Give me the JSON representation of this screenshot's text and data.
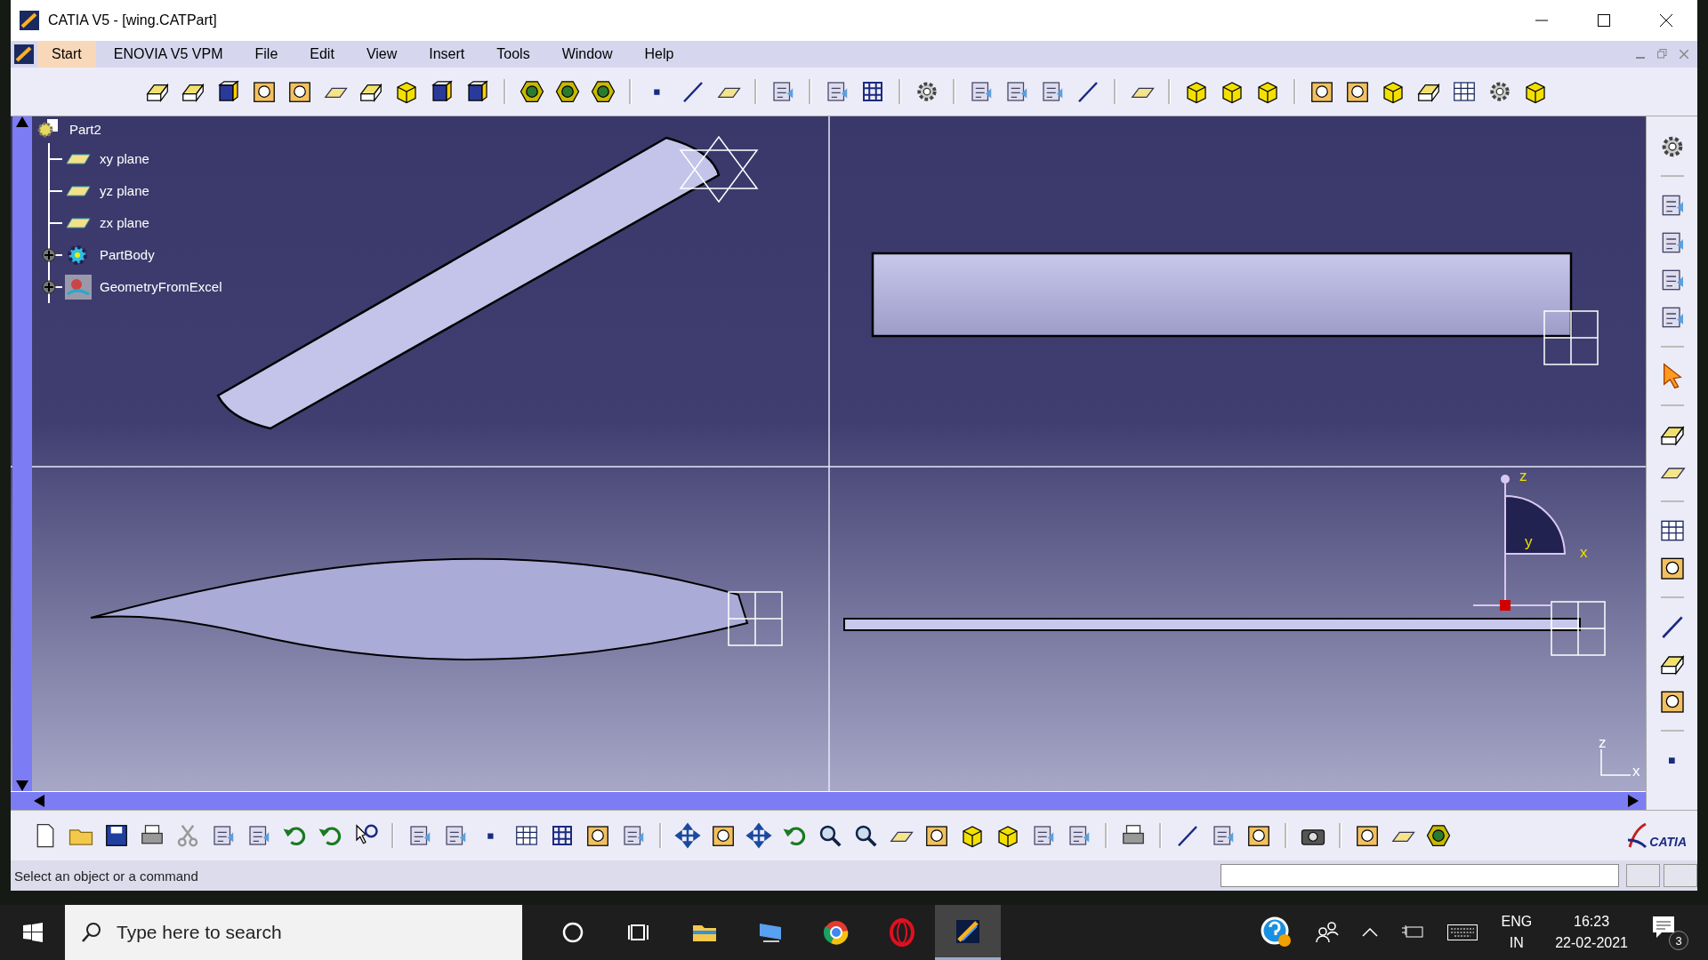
{
  "window": {
    "title": "CATIA V5 - [wing.CATPart]"
  },
  "menu": [
    {
      "label": "Start",
      "selected": true
    },
    {
      "label": "ENOVIA V5 VPM",
      "selected": false
    },
    {
      "label": "File",
      "selected": false
    },
    {
      "label": "Edit",
      "selected": false
    },
    {
      "label": "View",
      "selected": false
    },
    {
      "label": "Insert",
      "selected": false
    },
    {
      "label": "Tools",
      "selected": false
    },
    {
      "label": "Window",
      "selected": false
    },
    {
      "label": "Help",
      "selected": false
    }
  ],
  "tree": {
    "label": "Part2",
    "kind": "part",
    "children": [
      {
        "label": "xy plane",
        "kind": "plane"
      },
      {
        "label": "yz plane",
        "kind": "plane"
      },
      {
        "label": "zx plane",
        "kind": "plane"
      },
      {
        "label": "PartBody",
        "kind": "body",
        "expanded": false
      },
      {
        "label": "GeometryFromExcel",
        "kind": "geometry",
        "expanded": false
      }
    ]
  },
  "viewport": {
    "triad_labels": [
      "z",
      "y",
      "x"
    ],
    "compass_labels": [
      "z",
      "x"
    ]
  },
  "logo": {
    "text": "CATIA"
  },
  "status_bar": {
    "message": "Select an object or a command"
  },
  "taskbar": {
    "search": {
      "placeholder": "Type here to search"
    },
    "apps": [
      {
        "kind": "circle",
        "selected": false
      },
      {
        "kind": "taskview",
        "selected": false
      },
      {
        "kind": "folder",
        "selected": false
      },
      {
        "kind": "monitor",
        "selected": false
      },
      {
        "kind": "browser",
        "selected": false
      },
      {
        "kind": "ring",
        "selected": false
      },
      {
        "kind": "catia",
        "selected": true
      }
    ],
    "tray": {
      "language": "ENG",
      "region": "IN",
      "time": "16:23",
      "date": "22-02-2021",
      "notification_count": "3"
    }
  }
}
